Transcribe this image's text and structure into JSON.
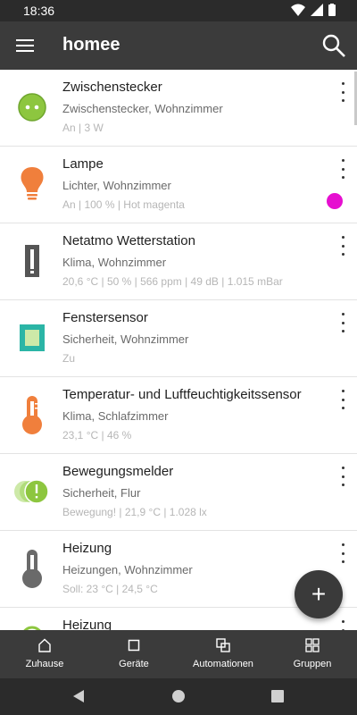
{
  "status_bar": {
    "time": "18:36"
  },
  "app_bar": {
    "title": "homee",
    "menu_icon": "hamburger-menu-icon",
    "search_icon": "search-icon"
  },
  "devices": [
    {
      "name": "Zwischenstecker",
      "subtitle": "Zwischenstecker, Wohnzimmer",
      "state": "An | 3 W",
      "icon": "plug-icon"
    },
    {
      "name": "Lampe",
      "subtitle": "Lichter, Wohnzimmer",
      "state": "An | 100 % | Hot magenta",
      "icon": "bulb-icon",
      "color": "#e60fd0"
    },
    {
      "name": "Netatmo Wetterstation",
      "subtitle": "Klima, Wohnzimmer",
      "state": "20,6 °C | 50 % | 566 ppm | 49 dB | 1.015 mBar",
      "icon": "weather-station-icon"
    },
    {
      "name": "Fenstersensor",
      "subtitle": "Sicherheit, Wohnzimmer",
      "state": "Zu",
      "icon": "window-sensor-icon"
    },
    {
      "name": "Temperatur- und Luftfeuchtigkeitssensor",
      "subtitle": "Klima, Schlafzimmer",
      "state": "23,1 °C | 46 %",
      "icon": "thermometer-icon"
    },
    {
      "name": "Bewegungsmelder",
      "subtitle": "Sicherheit, Flur",
      "state": "Bewegung! | 21,9 °C | 1.028 lx",
      "icon": "motion-sensor-icon"
    },
    {
      "name": "Heizung",
      "subtitle": "Heizungen, Wohnzimmer",
      "state": "Soll: 23 °C | 24,5 °C",
      "icon": "heating-icon"
    },
    {
      "name": "Heizung",
      "subtitle": "",
      "state": "",
      "icon": "heating-icon"
    }
  ],
  "fab": {
    "label": "+"
  },
  "bottom_nav": [
    {
      "label": "Zuhause",
      "icon": "home-icon"
    },
    {
      "label": "Geräte",
      "icon": "devices-icon"
    },
    {
      "label": "Automationen",
      "icon": "automations-icon"
    },
    {
      "label": "Gruppen",
      "icon": "groups-icon"
    }
  ],
  "colors": {
    "accent_green": "#8dc63f",
    "accent_orange": "#f07f3c",
    "accent_teal": "#2bb5a6",
    "bar_dark": "#3b3b3b"
  }
}
